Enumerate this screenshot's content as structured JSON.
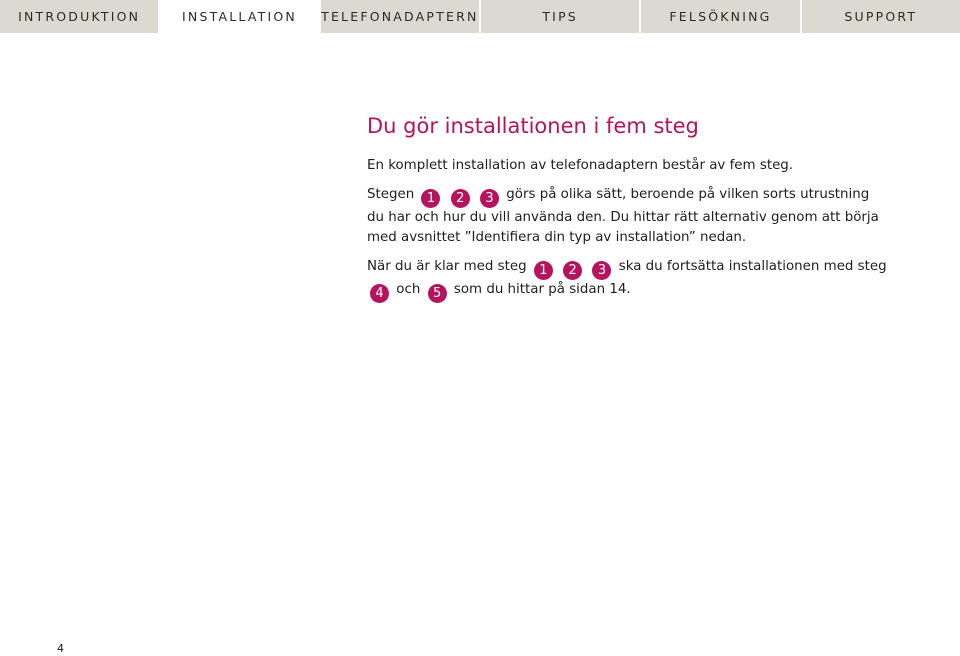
{
  "nav": {
    "tabs": [
      {
        "label": "INTRODUKTION"
      },
      {
        "label": "INSTALLATION"
      },
      {
        "label": "TELEFONADAPTERN"
      },
      {
        "label": "TIPS"
      },
      {
        "label": "FELSÖKNING"
      },
      {
        "label": "SUPPORT"
      }
    ],
    "active_index": 1
  },
  "main": {
    "title": "Du gör installationen i fem steg",
    "p1": "En komplett installation av telefonadaptern består av fem steg.",
    "p2": {
      "t1": "Stegen",
      "t2": "görs på olika sätt, beroende på vilken sorts utrustning du har och hur du vill använda den. Du hittar rätt alternativ genom att börja med avsnittet ”Identifiera din typ av installation” nedan."
    },
    "p3": {
      "t1": "När du är klar med steg",
      "t2": "ska du fortsätta installationen med steg",
      "t3": "och",
      "t4": "som du hittar på sidan 14."
    },
    "steps": [
      "1",
      "2",
      "3",
      "4",
      "5"
    ]
  },
  "footer": {
    "page_number": "4"
  },
  "colors": {
    "accent": "#b5135e",
    "tab_bg": "#dcd9d1"
  }
}
